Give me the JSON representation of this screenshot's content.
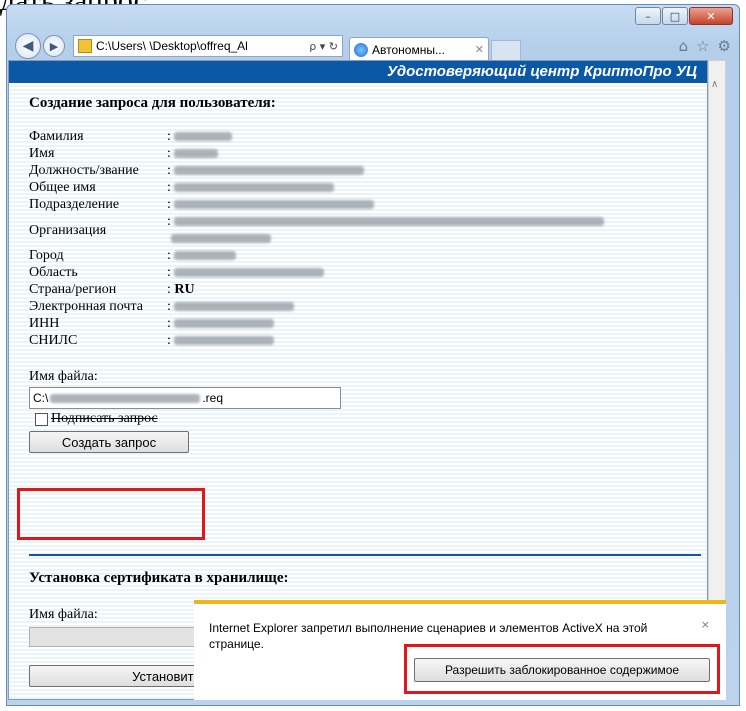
{
  "doc_caption": "дать запрос.",
  "window": {
    "controls": {
      "minimize": "–",
      "maximize": "□",
      "close": "✕"
    }
  },
  "address_bar": {
    "url": "C:\\Users\\         \\Desktop\\offreq_Al",
    "tools": "ρ ▾ ↻"
  },
  "tab": {
    "label": "Автономны...",
    "close": "✕"
  },
  "toolbar_icons": {
    "home": "⌂",
    "favorites": "☆",
    "settings": "⚙"
  },
  "page": {
    "banner": "Удостоверяющий центр КриптоПро УЦ",
    "section1_title": "Создание запроса для пользователя:",
    "fields": [
      {
        "label": "Фамилия",
        "blur_width": 58
      },
      {
        "label": "Имя",
        "blur_width": 44
      },
      {
        "label": "Должность/звание",
        "blur_width": 190
      },
      {
        "label": "Общее имя",
        "blur_width": 160
      },
      {
        "label": "Подразделение",
        "blur_width": 200
      },
      {
        "label": "Организация",
        "blur_width": 430,
        "multiline": true
      },
      {
        "label": "Город",
        "blur_width": 62
      },
      {
        "label": "Область",
        "blur_width": 150
      },
      {
        "label": "Страна/регион",
        "value": "RU"
      },
      {
        "label": "Электронная почта",
        "blur_width": 120
      },
      {
        "label": "ИНН",
        "blur_width": 100
      },
      {
        "label": "СНИЛС",
        "blur_width": 100
      }
    ],
    "file_label": "Имя файла:",
    "file_value_prefix": "C:\\",
    "file_value_suffix": ".req",
    "sign_checkbox_label": "Подписать запрос",
    "create_button": "Создать запрос",
    "section2_title": "Установка сертификата в хранилище:",
    "file2_label": "Имя файла:",
    "install_button": "Установить серти"
  },
  "notification": {
    "text": "Internet Explorer запретил выполнение сценариев и элементов ActiveX на этой странице.",
    "allow_button": "Разрешить заблокированное содержимое",
    "close": "×"
  },
  "colors": {
    "banner": "#0a58a6",
    "highlight": "#e2171c",
    "notify_accent": "#f0b41d"
  }
}
